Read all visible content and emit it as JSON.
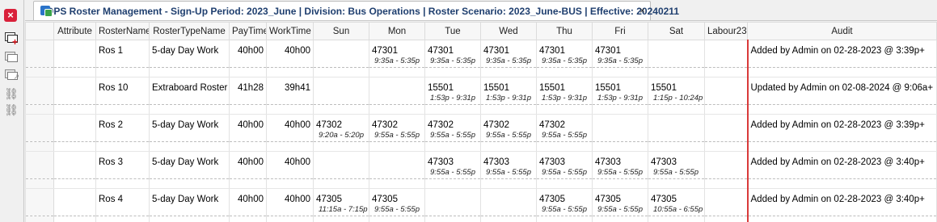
{
  "tab": {
    "title": "OPS Roster Management - Sign-Up Period: 2023_June | Division: Bus Operations | Roster Scenario: 2023_June-BUS | Effective: 20240211",
    "close_glyph": "×"
  },
  "toolbar": {
    "close_glyph": "×",
    "icons": [
      "close-icon",
      "add-roster-icon",
      "roster-copy-icon",
      "roster-edit-icon",
      "link-icon",
      "unlink-icon"
    ]
  },
  "columns": [
    "Attribute",
    "RosterName",
    "RosterTypeName",
    "PayTime",
    "WorkTime",
    "Sun",
    "Mon",
    "Tue",
    "Wed",
    "Thu",
    "Fri",
    "Sat",
    "Labour23",
    "Audit"
  ],
  "rows": [
    {
      "name": "Ros 1",
      "type": "5-day Day Work",
      "pay": "40h00",
      "work": "40h00",
      "days": [
        {
          "run": "",
          "time": ""
        },
        {
          "run": "47301",
          "time": "9:35a - 5:35p"
        },
        {
          "run": "47301",
          "time": "9:35a - 5:35p"
        },
        {
          "run": "47301",
          "time": "9:35a - 5:35p"
        },
        {
          "run": "47301",
          "time": "9:35a - 5:35p"
        },
        {
          "run": "47301",
          "time": "9:35a - 5:35p"
        },
        {
          "run": "",
          "time": ""
        }
      ],
      "audit": "Added by Admin on 02-28-2023 @  3:39p+"
    },
    {
      "name": "Ros 10",
      "type": "Extraboard Roster",
      "pay": "41h28",
      "work": "39h41",
      "days": [
        {
          "run": "",
          "time": ""
        },
        {
          "run": "",
          "time": ""
        },
        {
          "run": "15501",
          "time": "1:53p - 9:31p"
        },
        {
          "run": "15501",
          "time": "1:53p - 9:31p"
        },
        {
          "run": "15501",
          "time": "1:53p - 9:31p"
        },
        {
          "run": "15501",
          "time": "1:53p - 9:31p"
        },
        {
          "run": "15501",
          "time": "1:15p - 10:24p"
        }
      ],
      "audit": "Updated by Admin on 02-08-2024 @  9:06a+"
    },
    {
      "name": "Ros 2",
      "type": "5-day Day Work",
      "pay": "40h00",
      "work": "40h00",
      "days": [
        {
          "run": "47302",
          "time": "9:20a - 5:20p"
        },
        {
          "run": "47302",
          "time": "9:55a - 5:55p"
        },
        {
          "run": "47302",
          "time": "9:55a - 5:55p"
        },
        {
          "run": "47302",
          "time": "9:55a - 5:55p"
        },
        {
          "run": "47302",
          "time": "9:55a - 5:55p"
        },
        {
          "run": "",
          "time": ""
        },
        {
          "run": "",
          "time": ""
        }
      ],
      "audit": "Added by Admin on 02-28-2023 @  3:39p+"
    },
    {
      "name": "Ros 3",
      "type": "5-day Day Work",
      "pay": "40h00",
      "work": "40h00",
      "days": [
        {
          "run": "",
          "time": ""
        },
        {
          "run": "",
          "time": ""
        },
        {
          "run": "47303",
          "time": "9:55a - 5:55p"
        },
        {
          "run": "47303",
          "time": "9:55a - 5:55p"
        },
        {
          "run": "47303",
          "time": "9:55a - 5:55p"
        },
        {
          "run": "47303",
          "time": "9:55a - 5:55p"
        },
        {
          "run": "47303",
          "time": "9:55a - 5:55p"
        }
      ],
      "audit": "Added by Admin on 02-28-2023 @  3:40p+"
    },
    {
      "name": "Ros 4",
      "type": "5-day Day Work",
      "pay": "40h00",
      "work": "40h00",
      "days": [
        {
          "run": "47305",
          "time": "11:15a - 7:15p"
        },
        {
          "run": "47305",
          "time": "9:55a - 5:55p"
        },
        {
          "run": "",
          "time": ""
        },
        {
          "run": "",
          "time": ""
        },
        {
          "run": "47305",
          "time": "9:55a - 5:55p"
        },
        {
          "run": "47305",
          "time": "9:55a - 5:55p"
        },
        {
          "run": "47305",
          "time": "10:55a - 6:55p"
        }
      ],
      "audit": "Added by Admin on 02-28-2023 @  3:40p+"
    }
  ]
}
